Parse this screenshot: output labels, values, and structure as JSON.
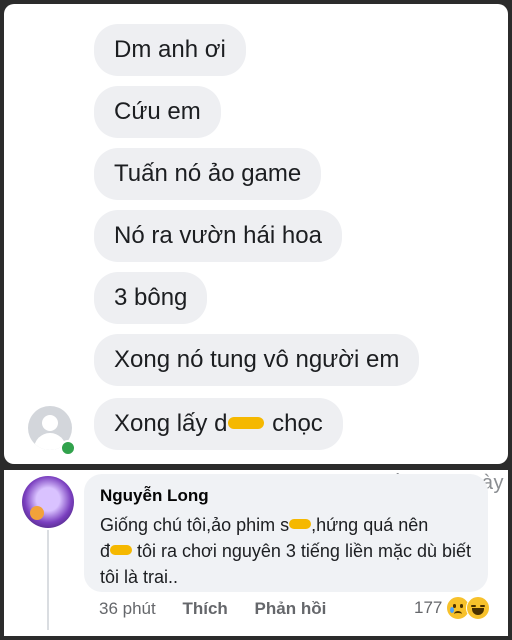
{
  "chat": {
    "messages": [
      "Dm anh ơi",
      "Cứu em",
      "Tuấn nó ảo game",
      "Nó ra vườn hái hoa",
      "3 bông",
      "Xong nó tung vô người em"
    ],
    "last_message_before": "Xong lấy d",
    "last_message_after": " chọc"
  },
  "watermark": "Chốn Lông Lày",
  "comment": {
    "author": "Nguyễn Long",
    "text_part1": "Giống chú tôi,ảo phim s",
    "text_part2": ",hứng quá nên",
    "text_part3": "đ",
    "text_part4": " tôi ra chơi nguyên 3 tiếng liền mặc dù biết tôi là trai..",
    "time": "36 phút",
    "like_label": "Thích",
    "reply_label": "Phản hồi",
    "reaction_count": "177",
    "reaction_icons": [
      "sad-icon",
      "haha-icon"
    ]
  },
  "colors": {
    "bubble": "#eeeff2",
    "online": "#31a24c",
    "censor": "#f5b800"
  }
}
